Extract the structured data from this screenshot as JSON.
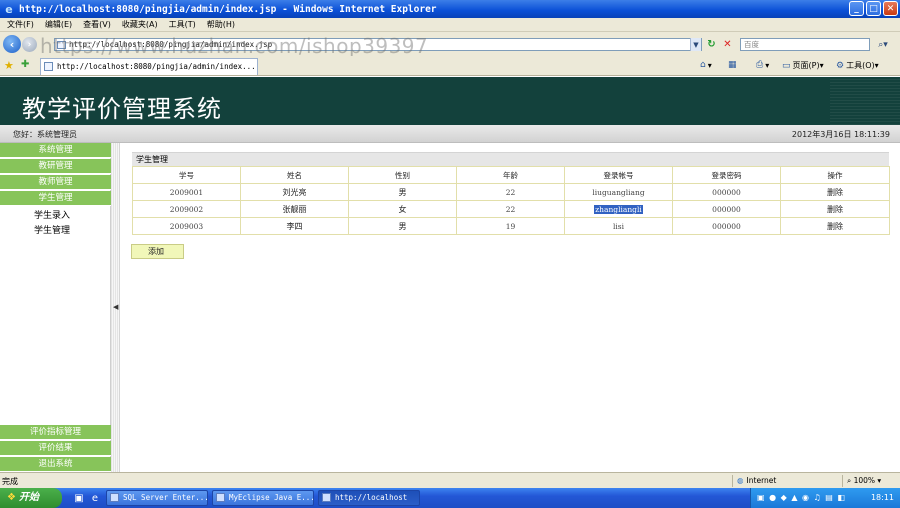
{
  "window": {
    "title": "http://localhost:8080/pingjia/admin/index.jsp - Windows Internet Explorer"
  },
  "menu": [
    "文件(F)",
    "编辑(E)",
    "查看(V)",
    "收藏夹(A)",
    "工具(T)",
    "帮助(H)"
  ],
  "address": {
    "url": "http://localhost:8080/pingjia/admin/index.jsp",
    "search_placeholder": "百度"
  },
  "watermark": "https://www.huzhan.com/ishop39397",
  "tab": {
    "label": "http://localhost:8080/pingjia/admin/index..."
  },
  "commands": {
    "page": "页面(P)",
    "tools": "工具(O)"
  },
  "app": {
    "title": "教学评价管理系统",
    "greeting": "您好：系统管理员",
    "datetime": "2012年3月16日  18:11:39"
  },
  "sidebar": {
    "top_groups": [
      "系统管理",
      "教研管理",
      "教师管理",
      "学生管理"
    ],
    "sub_items": [
      "学生录入",
      "学生管理"
    ],
    "bottom_groups": [
      "评价指标管理",
      "评价结果",
      "退出系统"
    ]
  },
  "panel": {
    "title": "学生管理"
  },
  "table": {
    "headers": [
      "学号",
      "姓名",
      "性别",
      "年龄",
      "登录帐号",
      "登录密码",
      "操作"
    ],
    "rows": [
      [
        "2009001",
        "刘光亮",
        "男",
        "22",
        "liuguangliang",
        "000000",
        "删除"
      ],
      [
        "2009002",
        "张靓丽",
        "女",
        "22",
        "zhangliangli",
        "000000",
        "删除"
      ],
      [
        "2009003",
        "李四",
        "男",
        "19",
        "lisi",
        "000000",
        "删除"
      ]
    ],
    "selected_cell": "zhangliangli"
  },
  "add_button": "添加",
  "status": {
    "text": "完成",
    "zone": "Internet",
    "zoom": "100%"
  },
  "taskbar": {
    "start": "开始",
    "tasks": [
      "SQL Server Enter...",
      "MyEclipse Java E...",
      "http://localhost"
    ],
    "clock": "18:11"
  }
}
